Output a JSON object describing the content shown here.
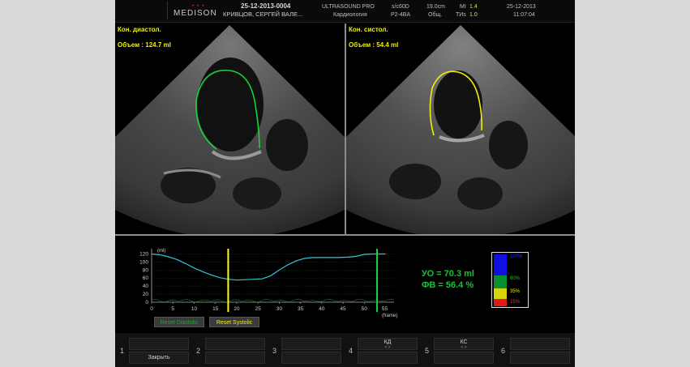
{
  "header": {
    "logo": "MEDISON",
    "patient_id": "25-12-2013-0004",
    "patient_name": "КРИВЦОВ, СЕРГЕЙ ВАЛЕ...",
    "system": "ULTRASOUND PRO",
    "app": "Кардиология",
    "mode": "s/c60D",
    "probe": "P2-4BA",
    "depth": "19.0cm",
    "preset": "Общ.",
    "mi_label": "MI",
    "mi_value": "1.4",
    "tis_label": "TИs",
    "tis_value": "1.0",
    "date": "25-12-2013",
    "time": "11:07:04"
  },
  "panes": {
    "left": {
      "title": "Кон. диастол.",
      "volume": "Объем : 124.7 ml"
    },
    "right": {
      "title": "Кон. систол.",
      "volume": "Объем : 54.4 ml"
    }
  },
  "chart": {
    "y_unit": "(ml)",
    "x_unit": "(frame)",
    "y_ticks": [
      "120",
      "100",
      "80",
      "60",
      "40",
      "20",
      "0"
    ],
    "x_ticks": [
      "0",
      "5",
      "10",
      "15",
      "20",
      "25",
      "30",
      "35",
      "40",
      "45",
      "50"
    ],
    "x_tick_extra": "55",
    "reset_diastolic": "Reset Diastolic",
    "reset_systolic": "Reset Systolic",
    "stroke_volume": "УО = 70.3 ml",
    "ejection_fraction": "ФВ = 56.4 %",
    "curve_color": "#36c2d6",
    "systolic_marker_color": "#ffff00",
    "diastolic_marker_color": "#19d13a"
  },
  "chart_data": {
    "type": "line",
    "xlabel": "(frame)",
    "ylabel": "(ml)",
    "xlim": [
      0,
      57
    ],
    "ylim": [
      0,
      125
    ],
    "series": [
      {
        "x": [
          0,
          2,
          4,
          6,
          8,
          10,
          12,
          14,
          16,
          18,
          20,
          22,
          24,
          26,
          28,
          30,
          32,
          34,
          36,
          38,
          40,
          42,
          44,
          46,
          48,
          50,
          52,
          53,
          55
        ],
        "y": [
          120,
          118,
          113,
          106,
          96,
          85,
          76,
          68,
          61,
          57,
          55,
          56,
          57,
          58,
          66,
          80,
          93,
          103,
          109,
          111,
          111,
          111,
          111,
          112,
          114,
          119,
          120,
          120,
          120
        ]
      }
    ],
    "markers": {
      "systolic_frame": 18,
      "diastolic_frame": 53
    }
  },
  "scale": {
    "labels": [
      "100%",
      "60%",
      "35%",
      "15%"
    ],
    "colors": [
      "#1010e0",
      "#0a8f2e",
      "#d6d60a",
      "#e01818"
    ],
    "label_colors": [
      "#2a2aff",
      "#19c23a",
      "#e6e60a",
      "#ff2a2a"
    ]
  },
  "softkeys": [
    {
      "num": "1",
      "label": "Закрыть",
      "arrows": ""
    },
    {
      "num": "2",
      "label": "",
      "arrows": ""
    },
    {
      "num": "3",
      "label": "",
      "arrows": ""
    },
    {
      "num": "4",
      "label": "КД",
      "arrows": "< >"
    },
    {
      "num": "5",
      "label": "КС",
      "arrows": "< >"
    },
    {
      "num": "6",
      "label": "",
      "arrows": ""
    }
  ]
}
